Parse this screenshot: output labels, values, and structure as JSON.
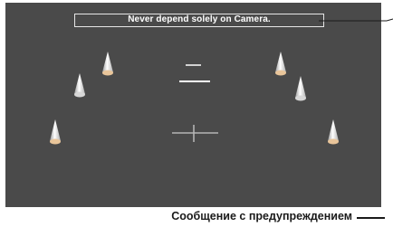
{
  "warning": {
    "message": "Never depend solely on Camera."
  },
  "callout": {
    "label": "Сообщение с предупреждением"
  },
  "colors": {
    "screen_background": "#4a4a4a",
    "speaker_light": "#ffffff",
    "speaker_shadow": "#a8a8a8",
    "speaker_base": "#e9c59a",
    "center_marks": "#ffffff",
    "crosshair": "#b4b4b4"
  },
  "speakers": [
    {
      "name": "front-left"
    },
    {
      "name": "front-right"
    },
    {
      "name": "center-left"
    },
    {
      "name": "center-right"
    },
    {
      "name": "surround-left"
    },
    {
      "name": "surround-right"
    }
  ]
}
